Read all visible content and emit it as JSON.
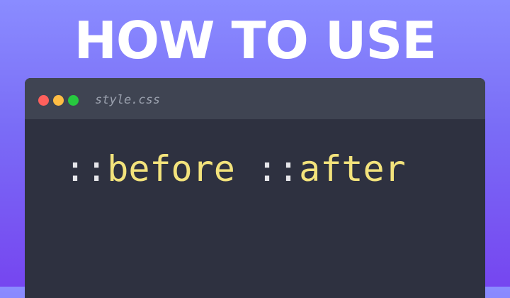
{
  "headline": "HOW TO USE",
  "editor": {
    "filename": "style.css",
    "window_controls": [
      {
        "name": "close",
        "color": "#ff605c"
      },
      {
        "name": "minimize",
        "color": "#ffbd44"
      },
      {
        "name": "maximize",
        "color": "#27c93f"
      }
    ],
    "code": {
      "prefix1": "::",
      "word1": "before",
      "prefix2": "::",
      "word2": "after"
    }
  },
  "colors": {
    "keyword": "#f3e37c",
    "punctuation": "#e6e6ea",
    "editor_bg": "#2e3140",
    "titlebar_bg": "#3f4452"
  }
}
